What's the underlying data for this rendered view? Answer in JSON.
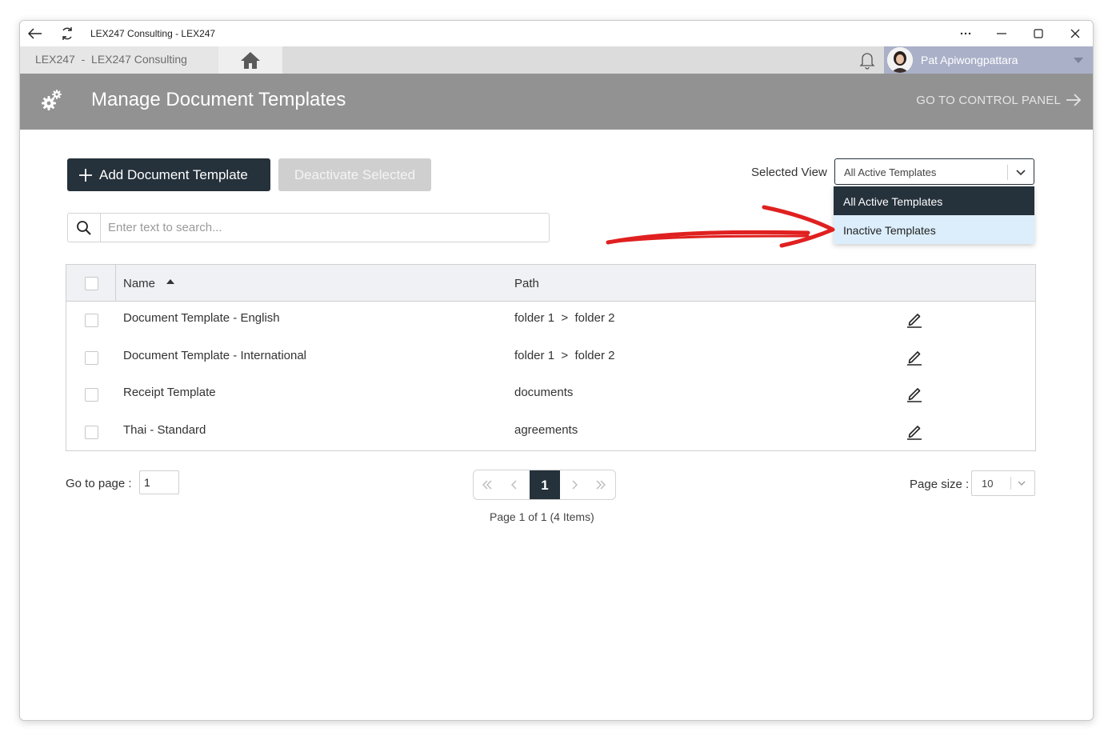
{
  "window": {
    "title": "LEX247 Consulting - LEX247"
  },
  "appbar": {
    "breadcrumb": "LEX247  -  LEX247 Consulting",
    "user_name": "Pat Apiwongpattara"
  },
  "header": {
    "title": "Manage Document Templates",
    "control_panel_link": "GO TO CONTROL PANEL"
  },
  "toolbar": {
    "add_label": "Add Document Template",
    "deactivate_label": "Deactivate Selected",
    "selected_view_label": "Selected View",
    "selected_view_value": "All Active Templates",
    "view_options": [
      "All Active Templates",
      "Inactive Templates"
    ]
  },
  "search": {
    "placeholder": "Enter text to search..."
  },
  "grid": {
    "columns": [
      "Name",
      "Path"
    ],
    "rows": [
      {
        "name": "Document Template - English",
        "path": "folder 1  >  folder 2"
      },
      {
        "name": "Document Template - International",
        "path": "folder 1  >  folder 2"
      },
      {
        "name": "Receipt Template",
        "path": "documents"
      },
      {
        "name": "Thai - Standard",
        "path": "agreements"
      }
    ]
  },
  "pagination": {
    "goto_label": "Go to page :",
    "goto_value": "1",
    "current_page": "1",
    "info": "Page 1 of 1 (4 Items)",
    "page_size_label": "Page size :",
    "page_size": "10"
  },
  "colors": {
    "primary_dark": "#25313b",
    "header_gray": "#929292",
    "user_area": "#aab0c8",
    "annotation_red": "#e02020"
  }
}
